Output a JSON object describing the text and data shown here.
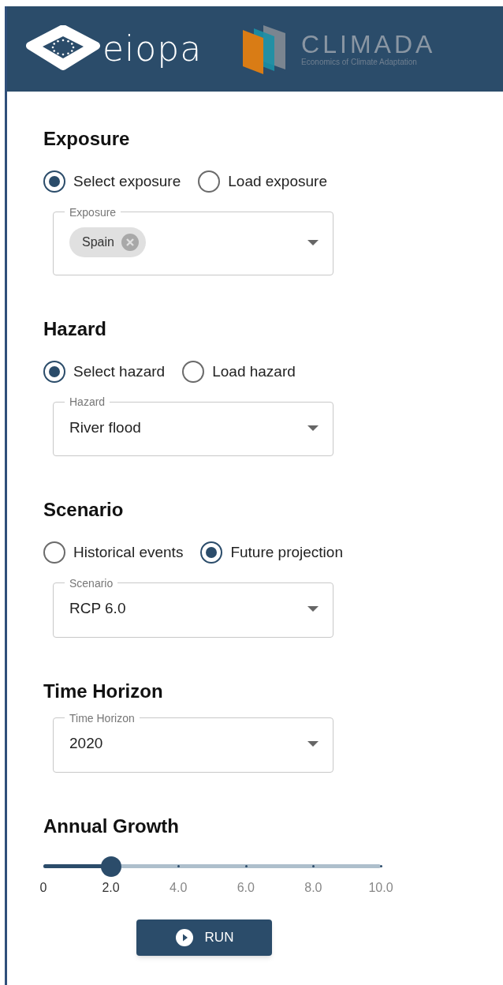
{
  "header": {
    "eiopa_logo": "eiopa",
    "climada_logo": "CLIMADA",
    "climada_tagline": "Economics of Climate Adaptation"
  },
  "sections": [
    {
      "kind": "select",
      "title": "Exposure",
      "radios": [
        {
          "label": "Select exposure",
          "selected": true
        },
        {
          "label": "Load exposure",
          "selected": false
        }
      ],
      "field": {
        "label": "Exposure",
        "chips": [
          "Spain"
        ]
      }
    },
    {
      "kind": "select",
      "title": "Hazard",
      "radios": [
        {
          "label": "Select hazard",
          "selected": true
        },
        {
          "label": "Load hazard",
          "selected": false
        }
      ],
      "field": {
        "label": "Hazard",
        "value": "River flood"
      }
    },
    {
      "kind": "select",
      "title": "Scenario",
      "radios": [
        {
          "label": "Historical events",
          "selected": false
        },
        {
          "label": "Future projection",
          "selected": true
        }
      ],
      "field": {
        "label": "Scenario",
        "value": "RCP 6.0"
      }
    },
    {
      "kind": "select",
      "title": "Time Horizon",
      "field": {
        "label": "Time Horizon",
        "value": "2020"
      }
    },
    {
      "kind": "slider",
      "title": "Annual Growth",
      "level": 0.2,
      "marks": [
        "0",
        "2.0",
        "4.0",
        "6.0",
        "8.0",
        "10.0"
      ]
    }
  ],
  "run_button": "RUN"
}
